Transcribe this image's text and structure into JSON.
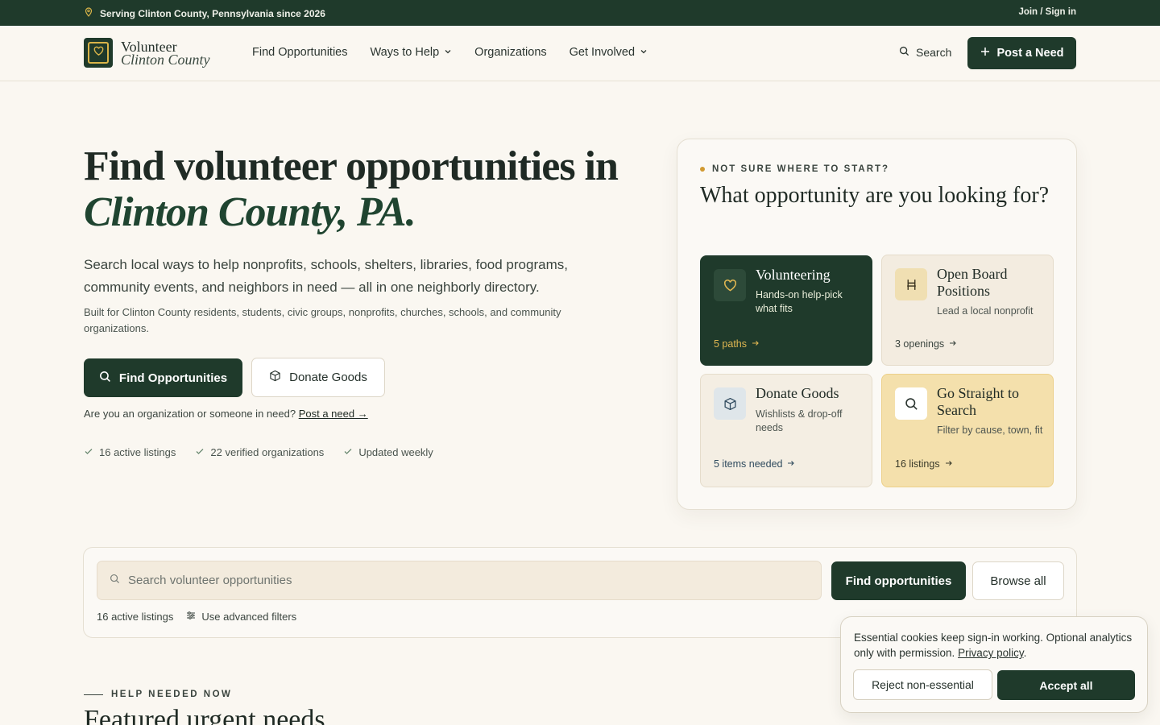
{
  "topbar": {
    "location_text": "Serving Clinton County, Pennsylvania since 2026",
    "signin_label": "Join / Sign in"
  },
  "header": {
    "logo_line1": "Volunteer",
    "logo_line2": "Clinton County",
    "nav": [
      "Find Opportunities",
      "Ways to Help",
      "Organizations",
      "Get Involved"
    ],
    "search_label": "Search",
    "post_label": "Post a Need"
  },
  "hero": {
    "title_line1": "Find volunteer opportunities in",
    "title_line2": "Clinton County, PA.",
    "subtitle": "Search local ways to help nonprofits, schools, shelters, libraries, food programs, community events, and neighbors in need — all in one neighborly directory.",
    "small_text": "Built for Clinton County residents, students, civic groups, nonprofits, churches, schools, and community organizations.",
    "primary_button": "Find Opportunities",
    "secondary_button": "Donate Goods",
    "org_question": "Are you an organization or someone in need?",
    "org_link": "Post a need →",
    "stats": [
      "16 active listings",
      "22 verified organizations",
      "Updated weekly"
    ]
  },
  "helper": {
    "eyebrow": "NOT SURE WHERE TO START?",
    "title": "What opportunity are you looking for?",
    "tiles": [
      {
        "name": "Volunteering",
        "desc": "Hands-on help-pick what fits",
        "foot": "5 paths"
      },
      {
        "name": "Open Board Positions",
        "desc": "Lead a local nonprofit",
        "foot": "3 openings"
      },
      {
        "name": "Donate Goods",
        "desc": "Wishlists & drop-off needs",
        "foot": "5 items needed"
      },
      {
        "name": "Go Straight to Search",
        "desc": "Filter by cause, town, fit",
        "foot": "16 listings"
      }
    ]
  },
  "search": {
    "placeholder": "Search volunteer opportunities",
    "find_button": "Find opportunities",
    "browse_button": "Browse all",
    "count_text": "16 active listings",
    "filters_link": "Use advanced filters"
  },
  "section": {
    "eyebrow": "HELP NEEDED NOW",
    "title": "Featured urgent needs"
  },
  "cookie": {
    "text": "Essential cookies keep sign-in working. Optional analytics only with permission.",
    "policy_link": "Privacy policy",
    "reject_label": "Reject non-essential",
    "accept_label": "Accept all"
  },
  "colors": {
    "brand_green": "#1f3a2b",
    "accent_gold": "#d9b449",
    "background": "#faf7f1"
  }
}
